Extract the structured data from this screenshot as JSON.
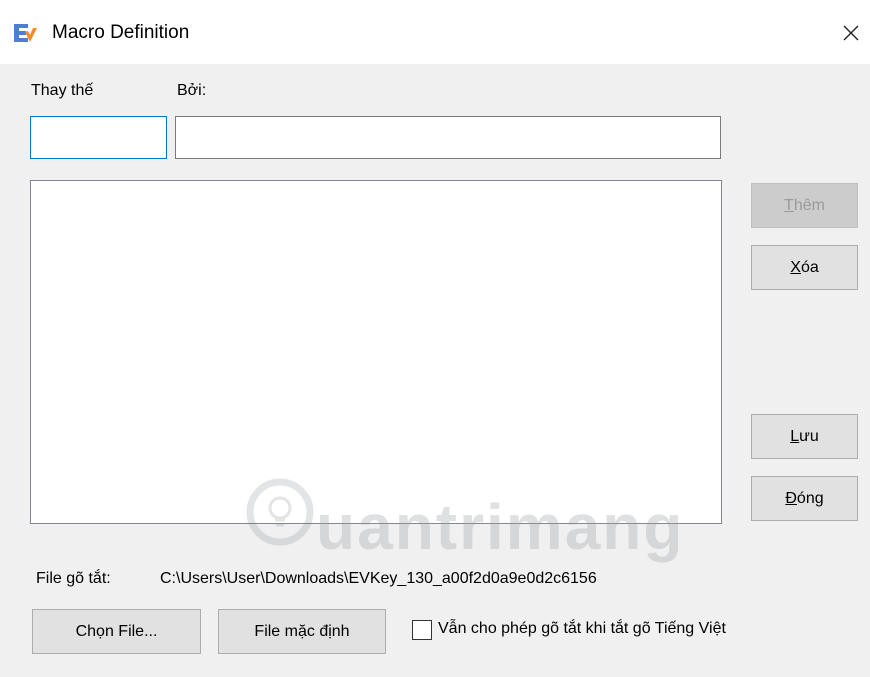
{
  "window": {
    "title": "Macro Definition",
    "close_label": "×"
  },
  "labels": {
    "thay_the": "Thay thế",
    "boi": "Bởi:"
  },
  "inputs": {
    "thay_the_value": "",
    "boi_value": ""
  },
  "buttons": {
    "them": {
      "pre": "",
      "key": "T",
      "post": "hêm",
      "enabled": false
    },
    "xoa": {
      "pre": "",
      "key": "X",
      "post": "óa",
      "enabled": true
    },
    "luu": {
      "pre": "",
      "key": "L",
      "post": "ưu",
      "enabled": true
    },
    "dong": {
      "pre": "",
      "key": "Đ",
      "post": "óng",
      "enabled": true
    },
    "chon_file": "Chọn File...",
    "file_mac_dinh": "File mặc định"
  },
  "file_section": {
    "label": "File gõ tắt:",
    "path": "C:\\Users\\User\\Downloads\\EVKey_130_a00f2d0a9e0d2c6156"
  },
  "checkbox": {
    "label": "Vẫn cho phép gõ tắt khi tắt gõ Tiếng Việt",
    "checked": false
  },
  "watermark": {
    "text": "uantrimang"
  },
  "colors": {
    "accent": "#0078d7",
    "window_bg": "#f0f0f0",
    "title_bg": "#ffffff"
  }
}
